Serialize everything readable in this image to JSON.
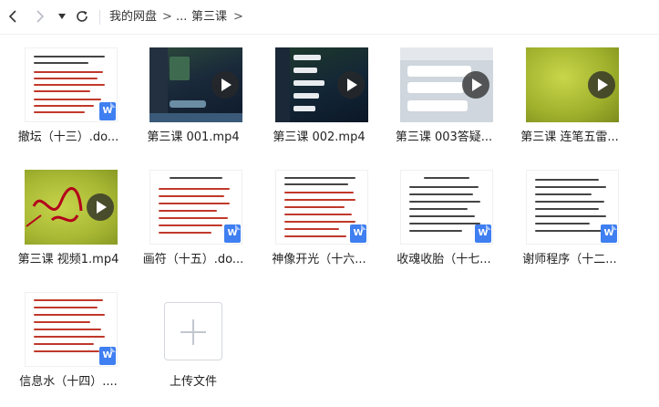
{
  "toolbar": {
    "breadcrumb": [
      "我的网盘",
      "...",
      "第三课"
    ],
    "separator": ">"
  },
  "files": [
    {
      "name": "撤坛（十三）.do...",
      "type": "doc"
    },
    {
      "name": "第三课 001.mp4",
      "type": "video"
    },
    {
      "name": "第三课 002.mp4",
      "type": "video"
    },
    {
      "name": "第三课 003答疑...",
      "type": "video"
    },
    {
      "name": "第三课 连笔五雷...",
      "type": "video"
    },
    {
      "name": "第三课 视频1.mp4",
      "type": "video"
    },
    {
      "name": "画符（十五）.do...",
      "type": "doc"
    },
    {
      "name": "神像开光（十六...",
      "type": "doc"
    },
    {
      "name": "收魂收胎（十七...",
      "type": "doc"
    },
    {
      "name": "谢师程序（十二...",
      "type": "doc"
    },
    {
      "name": "信息水（十四）....",
      "type": "doc"
    }
  ],
  "upload": {
    "label": "上传文件"
  },
  "colors": {
    "accent": "#3f7ff1",
    "doc_text": "#c0392b",
    "video_bg": "#1b2230"
  },
  "icons": {
    "word_badge": "W"
  }
}
